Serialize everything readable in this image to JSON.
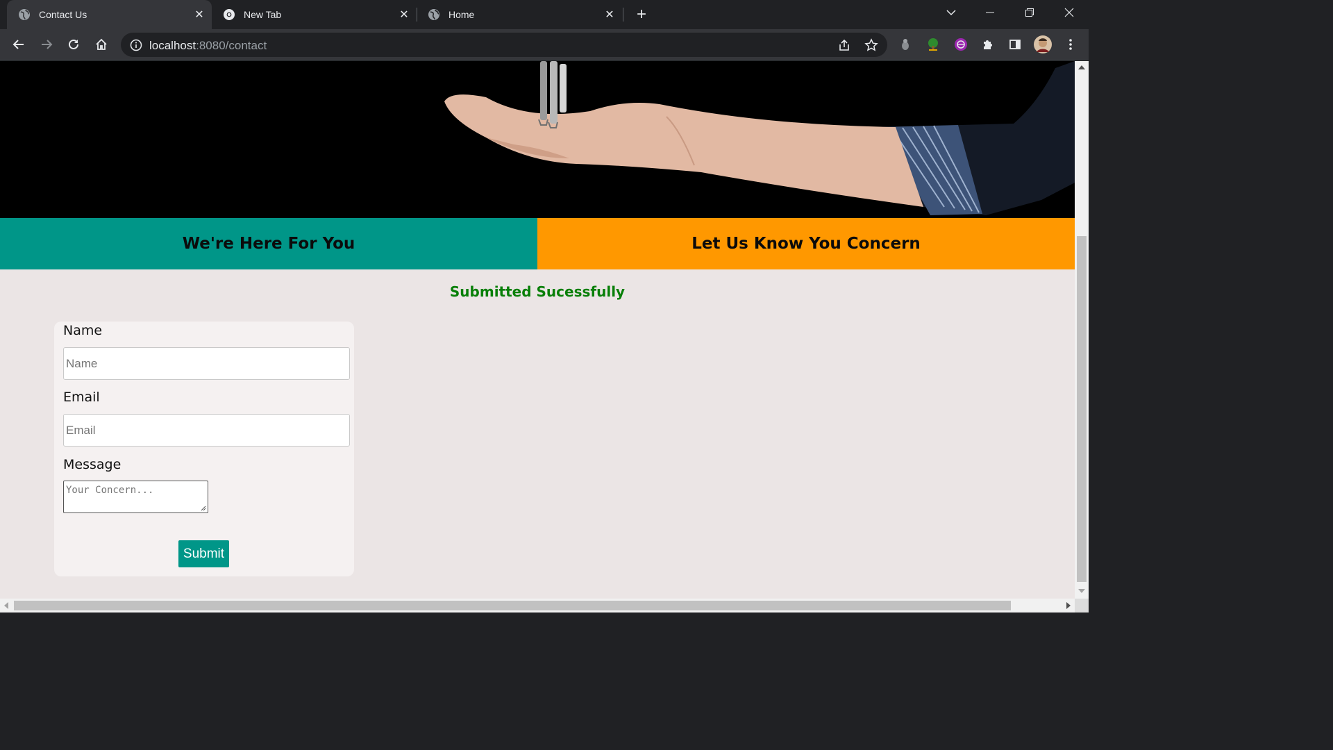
{
  "browser": {
    "tabs": [
      {
        "title": "Contact Us",
        "active": true,
        "icon": "globe-icon"
      },
      {
        "title": "New Tab",
        "active": false,
        "icon": "chrome-icon"
      },
      {
        "title": "Home",
        "active": false,
        "icon": "globe-icon"
      }
    ],
    "url_host": "localhost",
    "url_path": ":8080/contact"
  },
  "page": {
    "band_left": "We're Here For You",
    "band_right": "Let Us Know You Concern",
    "success_message": "Submitted Sucessfully",
    "form": {
      "name_label": "Name",
      "name_placeholder": "Name",
      "email_label": "Email",
      "email_placeholder": "Email",
      "message_label": "Message",
      "message_placeholder": "Your Concern...",
      "submit_label": "Submit"
    }
  },
  "colors": {
    "teal": "#009688",
    "orange": "#ff9800",
    "success_green": "#087f08"
  }
}
